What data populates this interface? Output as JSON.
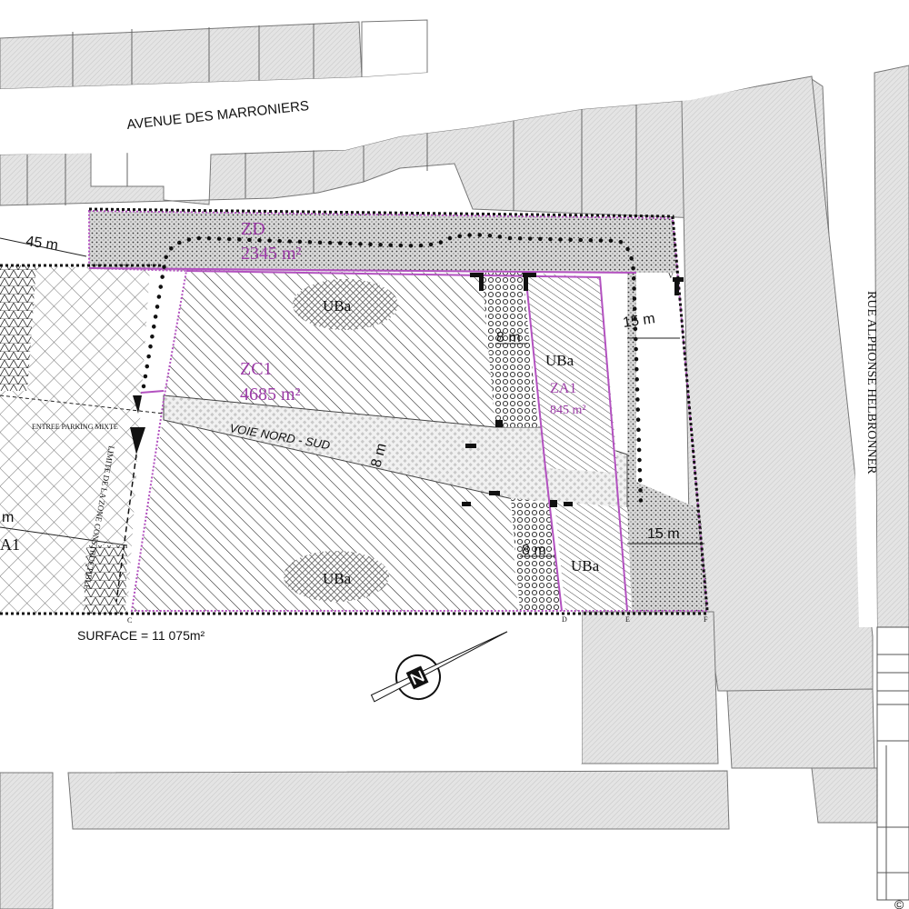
{
  "streets": {
    "avenue": "AVENUE DES MARRONIERS",
    "rue": "RUE ALPHONSE HELBRONNER",
    "voie": "VOIE NORD - SUD"
  },
  "zones": {
    "zd_name": "ZD",
    "zd_area": "2345 m²",
    "zc1_name": "ZC1",
    "zc1_area": "4685 m²",
    "za1_name": "ZA1",
    "za1_area": "845 m²",
    "za1_left_partial": "A1",
    "uba_top": "UBa",
    "uba_mid_right": "UBa",
    "uba_bottom": "UBa",
    "uba_bottom_right": "UBa"
  },
  "dimensions": {
    "d45": "45 m",
    "d15_top": "15 m",
    "d15_bottom": "15 m",
    "d8_top": "8 m",
    "d8_voie": "8 m",
    "d8_bottom": "8 m",
    "m_left_partial": "m"
  },
  "labels": {
    "parking": "ENTREE PARKING MIXTE",
    "limite": "LIMITE DE LA ZONE CONSTRUCTIBLE",
    "surface": "SURFACE = 11 075m²",
    "copyright": "©"
  },
  "points": [
    "C",
    "D",
    "E",
    "F",
    "V"
  ],
  "colors": {
    "zone_outline": "#b352c0",
    "zone_text": "#9b3aa6",
    "buildings": "#e2e2e2",
    "building_edge": "#777777"
  }
}
